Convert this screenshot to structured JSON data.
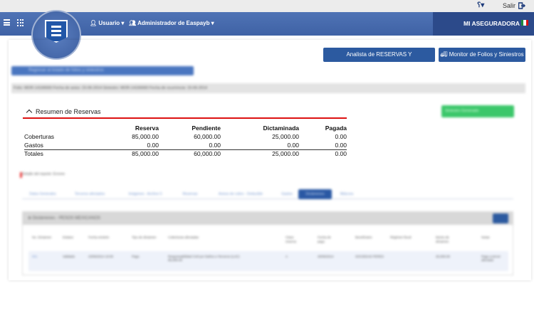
{
  "topbar": {
    "help_icon": "help-icon",
    "logout_label": "Salir",
    "logout_icon": "exit-icon"
  },
  "navbar": {
    "user_menu": "Usuario",
    "admin_menu": "Administrador de Easpayb",
    "company": "MI ASEGURADORA",
    "flag_colors": [
      "#1f8a3b",
      "#ffffff",
      "#d11"
    ],
    "brand_color": "#3f62a5"
  },
  "actions": {
    "analista_button": "Analista de RESERVAS Y DICTAMINACION",
    "monitor_button": "Monitor de Folios y Siniestros"
  },
  "blurred": {
    "return_bar": "Regresar al listado de folios y siniestros",
    "info_strip": "Folio: MOR-14166660  Fecha de aviso: 23-06-2014  Siniestro: MOR-14166660  Fecha de ocurrencia: 15-06-2014",
    "green_button": "Siniestro Generado",
    "alert": "Detalle del reporte: Errores",
    "tabs": [
      "Datos Generales",
      "Terceros afectados",
      "Imágenes - Archivo 5",
      "Reservas",
      "Avisos de cobro - Deducible",
      "Gastos",
      "Dictámenes",
      "Bitácora"
    ],
    "active_tab": 6,
    "panel_title": "Dictámenes - PESOS MEXICANOS",
    "grid_headers": [
      "No. Dictamen",
      "Estatus",
      "Fecha emisión",
      "Tipo de dictamen",
      "Coberturas afectadas",
      "Clave reserva",
      "Fecha de pago",
      "Beneficiario",
      "Régimen fiscal",
      "Monto de dictamen",
      "Notas"
    ],
    "grid_row": [
      "001",
      "Validado",
      "23/06/2014 10:00",
      "Pago",
      "Responsabilidad Civil por Daños a Terceros (LUC) 85,000.00",
      "A",
      "25/06/2014",
      "SOCIEDAD PERES",
      "",
      "25,000.00",
      "Pago a tercer afectado"
    ]
  },
  "resumen": {
    "title": "Resumen de Reservas",
    "headers": [
      "",
      "Reserva",
      "Pendiente",
      "Dictaminada",
      "Pagada"
    ],
    "rows": [
      [
        "Coberturas",
        "85,000.00",
        "60,000.00",
        "25,000.00",
        "0.00"
      ],
      [
        "Gastos",
        "0.00",
        "0.00",
        "0.00",
        "0.00"
      ]
    ],
    "totals": [
      "Totales",
      "85,000.00",
      "60,000.00",
      "25,000.00",
      "0.00"
    ],
    "accent_color": "#d11"
  }
}
